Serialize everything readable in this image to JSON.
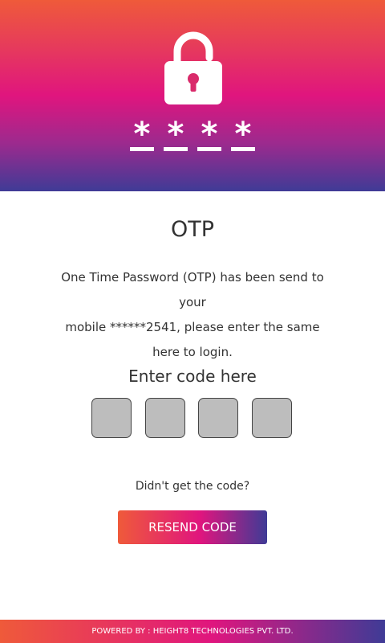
{
  "header": {
    "icon": "lock-icon",
    "password_stars": [
      "*",
      "*",
      "*",
      "*"
    ]
  },
  "main": {
    "title": "OTP",
    "description_lines": [
      "One Time Password (OTP) has been send to your",
      "mobile ******2541, please enter the same",
      "here to login."
    ],
    "enter_label": "Enter code here",
    "code_boxes": [
      "",
      "",
      "",
      ""
    ],
    "didnt_get_label": "Didn't get the code?",
    "resend_label": "RESEND CODE"
  },
  "footer": {
    "text": "POWERED BY : HEIGHT8 TECHNOLOGIES PVT. LTD."
  },
  "colors": {
    "gradient_top": "#ef5a3a",
    "gradient_mid": "#e0157e",
    "gradient_bottom": "#3f3b96",
    "code_box": "#bdbdbd"
  }
}
